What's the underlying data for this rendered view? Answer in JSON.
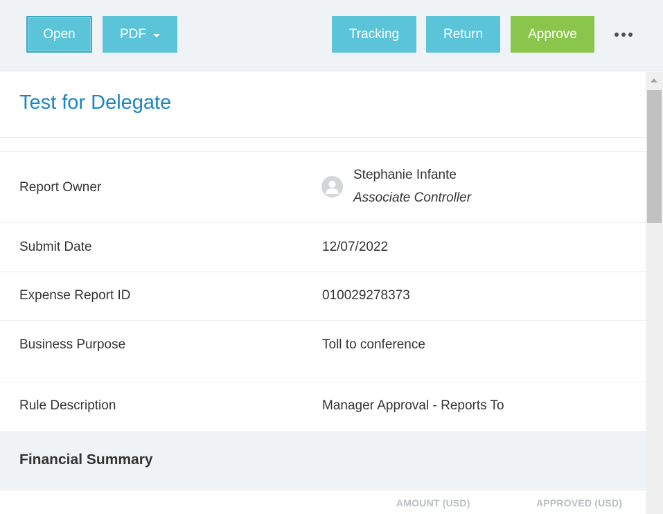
{
  "toolbar": {
    "open_label": "Open",
    "pdf_label": "PDF",
    "tracking_label": "Tracking",
    "return_label": "Return",
    "approve_label": "Approve",
    "more_icon": "ellipsis-icon"
  },
  "report": {
    "title": "Test for Delegate",
    "owner_label": "Report Owner",
    "owner_name": "Stephanie Infante",
    "owner_role": "Associate Controller",
    "submit_date_label": "Submit Date",
    "submit_date": "12/07/2022",
    "id_label": "Expense Report ID",
    "id_value": "010029278373",
    "purpose_label": "Business Purpose",
    "purpose_value": "Toll to conference",
    "rule_label": "Rule Description",
    "rule_value": "Manager Approval - Reports To"
  },
  "financial_summary": {
    "title": "Financial Summary",
    "columns": [
      "AMOUNT (USD)",
      "APPROVED (USD)"
    ]
  },
  "colors": {
    "button": "#5bc4d8",
    "approve": "#8ac64b",
    "title": "#1a86bf"
  }
}
